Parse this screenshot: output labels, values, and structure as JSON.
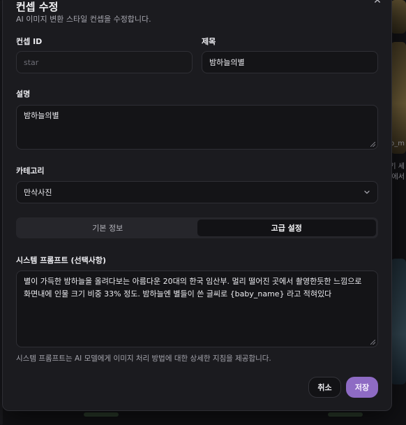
{
  "background": {
    "peek_text_1": "o_m",
    "peek_text_2": "기 세",
    "peek_text_3": "에서"
  },
  "modal": {
    "title": "컨셉 수정",
    "description": "AI 이미지 변환 스타일 컨셉을 수정합니다.",
    "close_icon": "close-icon"
  },
  "form": {
    "concept_id": {
      "label": "컨셉 ID",
      "placeholder": "star",
      "value": ""
    },
    "title": {
      "label": "제목",
      "value": "밤하늘의별"
    },
    "description": {
      "label": "설명",
      "value": "밤하늘의별"
    },
    "category": {
      "label": "카테고리",
      "selected": "만삭사진"
    },
    "tabs": [
      {
        "label": "기본 정보",
        "active": false
      },
      {
        "label": "고급 설정",
        "active": true
      }
    ],
    "system_prompt": {
      "label": "시스템 프롬프트 (선택사항)",
      "value": "별이 가득한 밤하늘을 올려다보는 아름다운 20대의 한국 임산부. 멀리 떨어진 곳에서 촬영한듯한 느낌으로 화면내에 인물 크기 비중 33% 정도. 밤하늘엔 별들이 쓴 글씨로 {baby_name}  라고 적혀있다",
      "help": "시스템 프롬프트는 AI 모델에게 이미지 처리 방법에 대한 상세한 지침을 제공합니다."
    }
  },
  "actions": {
    "cancel": "취소",
    "save": "저장"
  },
  "colors": {
    "accent": "#8e6bc4",
    "modal_bg": "#1b1b1f",
    "field_bg": "#141417"
  }
}
